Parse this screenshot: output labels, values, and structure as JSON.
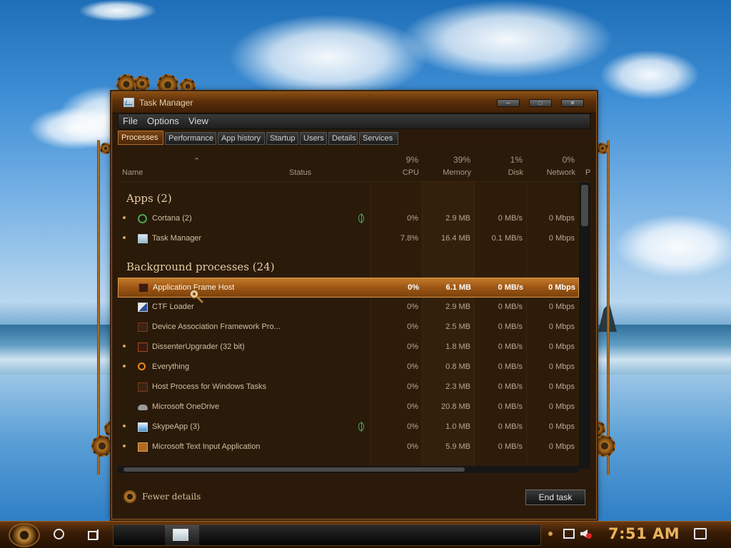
{
  "window": {
    "title": "Task Manager",
    "caption_buttons": [
      "min",
      "max",
      "close"
    ]
  },
  "menu": [
    "File",
    "Options",
    "View"
  ],
  "tabs": [
    "Processes",
    "Performance",
    "App history",
    "Startup",
    "Users",
    "Details",
    "Services"
  ],
  "active_tab": "Processes",
  "columns": {
    "name": "Name",
    "status": "Status",
    "cpu_pct": "9%",
    "cpu": "CPU",
    "memory_pct": "39%",
    "memory": "Memory",
    "disk_pct": "1%",
    "disk": "Disk",
    "network_pct": "0%",
    "network": "Network",
    "power_trunc": "Po"
  },
  "groups": {
    "apps_title": "Apps (2)",
    "bg_title": "Background processes (24)"
  },
  "apps": [
    {
      "name": "Cortana (2)",
      "cpu": "0%",
      "memory": "2.9 MB",
      "disk": "0 MB/s",
      "network": "0 Mbps",
      "icon": "cortana-icon"
    },
    {
      "name": "Task Manager",
      "cpu": "7.8%",
      "memory": "16.4 MB",
      "disk": "0.1 MB/s",
      "network": "0 Mbps",
      "icon": "task-manager-icon"
    }
  ],
  "background": [
    {
      "name": "Application Frame Host",
      "cpu": "0%",
      "memory": "6.1 MB",
      "disk": "0 MB/s",
      "network": "0 Mbps",
      "icon": "app-frame-icon"
    },
    {
      "name": "CTF Loader",
      "cpu": "0%",
      "memory": "2.9 MB",
      "disk": "0 MB/s",
      "network": "0 Mbps",
      "icon": "ctf-icon"
    },
    {
      "name": "Device Association Framework Pro...",
      "cpu": "0%",
      "memory": "2.5 MB",
      "disk": "0 MB/s",
      "network": "0 Mbps",
      "icon": "device-icon"
    },
    {
      "name": "DissenterUpgrader (32 bit)",
      "cpu": "0%",
      "memory": "1.8 MB",
      "disk": "0 MB/s",
      "network": "0 Mbps",
      "icon": "dissenter-icon"
    },
    {
      "name": "Everything",
      "cpu": "0%",
      "memory": "0.8 MB",
      "disk": "0 MB/s",
      "network": "0 Mbps",
      "icon": "search-icon"
    },
    {
      "name": "Host Process for Windows Tasks",
      "cpu": "0%",
      "memory": "2.3 MB",
      "disk": "0 MB/s",
      "network": "0 Mbps",
      "icon": "host-process-icon"
    },
    {
      "name": "Microsoft OneDrive",
      "cpu": "0%",
      "memory": "20.8 MB",
      "disk": "0 MB/s",
      "network": "0 Mbps",
      "icon": "cloud-icon"
    },
    {
      "name": "SkypeApp (3)",
      "cpu": "0%",
      "memory": "1.0 MB",
      "disk": "0 MB/s",
      "network": "0 Mbps",
      "icon": "skype-icon"
    },
    {
      "name": "Microsoft Text Input Application",
      "cpu": "0%",
      "memory": "5.9 MB",
      "disk": "0 MB/s",
      "network": "0 Mbps",
      "icon": "text-input-icon"
    }
  ],
  "selected_process": "Application Frame Host",
  "footer": {
    "fewer_details": "Fewer details",
    "end_task": "End task"
  },
  "taskbar": {
    "clock": "7:51 AM"
  },
  "colors": {
    "accent": "#b06c24",
    "clock": "#e9b45a",
    "selection": "#9b5614"
  }
}
